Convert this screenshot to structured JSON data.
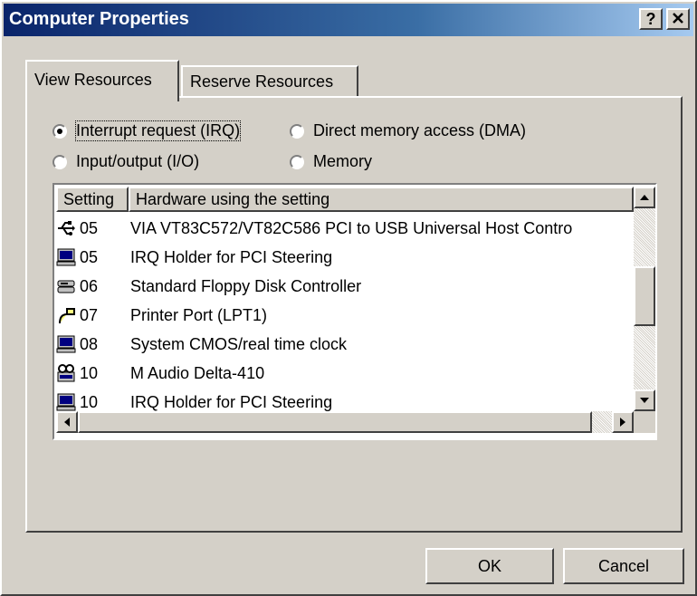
{
  "window": {
    "title": "Computer Properties",
    "help_label": "?",
    "close_label": "✕"
  },
  "tabs": [
    {
      "label": "View Resources",
      "active": true
    },
    {
      "label": "Reserve Resources",
      "active": false
    }
  ],
  "options": {
    "irq": {
      "label": "Interrupt request (IRQ)",
      "checked": true
    },
    "dma": {
      "label": "Direct memory access (DMA)",
      "checked": false
    },
    "io": {
      "label": "Input/output (I/O)",
      "checked": false
    },
    "memory": {
      "label": "Memory",
      "checked": false
    }
  },
  "list": {
    "columns": [
      "Setting",
      "Hardware using the setting"
    ],
    "rows": [
      {
        "icon": "usb-icon",
        "setting": "05",
        "hardware": "VIA VT83C572/VT82C586 PCI to USB Universal Host Contro"
      },
      {
        "icon": "computer-icon",
        "setting": "05",
        "hardware": "IRQ Holder for PCI Steering"
      },
      {
        "icon": "floppy-controller-icon",
        "setting": "06",
        "hardware": "Standard Floppy Disk Controller"
      },
      {
        "icon": "printer-port-icon",
        "setting": "07",
        "hardware": "Printer Port (LPT1)"
      },
      {
        "icon": "computer-icon",
        "setting": "08",
        "hardware": "System CMOS/real time clock"
      },
      {
        "icon": "sound-device-icon",
        "setting": "10",
        "hardware": "M Audio Delta-410"
      },
      {
        "icon": "computer-icon",
        "setting": "10",
        "hardware": "IRQ Holder for PCI Steering"
      }
    ]
  },
  "buttons": {
    "ok": "OK",
    "cancel": "Cancel"
  },
  "colors": {
    "face": "#d4d0c8",
    "title_start": "#0a246a",
    "title_end": "#a6caf0"
  }
}
